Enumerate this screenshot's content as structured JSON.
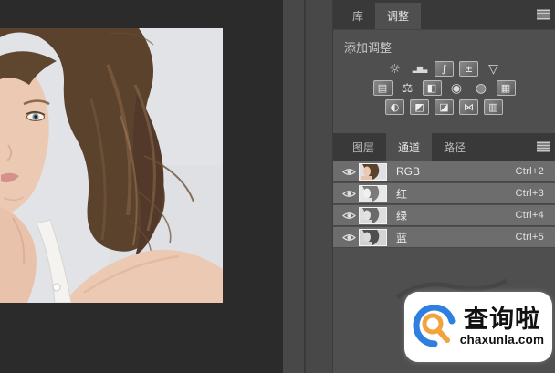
{
  "adjustments_panel": {
    "tabs": [
      {
        "label": "库",
        "active": false
      },
      {
        "label": "调整",
        "active": true
      }
    ],
    "header": "添加调整",
    "icon_rows": [
      [
        {
          "name": "brightness-contrast",
          "glyph": "☼"
        },
        {
          "name": "levels",
          "glyph": "▂▆▃"
        },
        {
          "name": "curves",
          "glyph": "∫"
        },
        {
          "name": "exposure",
          "glyph": "±"
        },
        {
          "name": "vibrance",
          "glyph": "▽"
        }
      ],
      [
        {
          "name": "hue-saturation",
          "glyph": "▤"
        },
        {
          "name": "color-balance",
          "glyph": "⚖"
        },
        {
          "name": "black-white",
          "glyph": "◧"
        },
        {
          "name": "photo-filter",
          "glyph": "◉"
        },
        {
          "name": "channel-mixer",
          "glyph": "◍"
        },
        {
          "name": "color-lookup",
          "glyph": "▦"
        }
      ],
      [
        {
          "name": "invert",
          "glyph": "◐"
        },
        {
          "name": "posterize",
          "glyph": "◩"
        },
        {
          "name": "threshold",
          "glyph": "◪"
        },
        {
          "name": "gradient-map",
          "glyph": "⋈"
        },
        {
          "name": "selective-color",
          "glyph": "▥"
        }
      ]
    ]
  },
  "channels_panel": {
    "tabs": [
      {
        "label": "图层",
        "active": false
      },
      {
        "label": "通道",
        "active": true
      },
      {
        "label": "路径",
        "active": false
      }
    ],
    "rows": [
      {
        "name": "RGB",
        "shortcut": "Ctrl+2"
      },
      {
        "name": "红",
        "shortcut": "Ctrl+3"
      },
      {
        "name": "绿",
        "shortcut": "Ctrl+4"
      },
      {
        "name": "蓝",
        "shortcut": "Ctrl+5"
      }
    ]
  },
  "watermark": {
    "title": "查询啦",
    "domain": "chaxunla.com",
    "brand_blue": "#2e7fe0",
    "brand_orange": "#f2a33c"
  },
  "colors": {
    "canvas": "#2b2b2b",
    "panel": "#4f4f4f",
    "tabbar": "#393939",
    "selected_row": "#6d6d6d"
  }
}
